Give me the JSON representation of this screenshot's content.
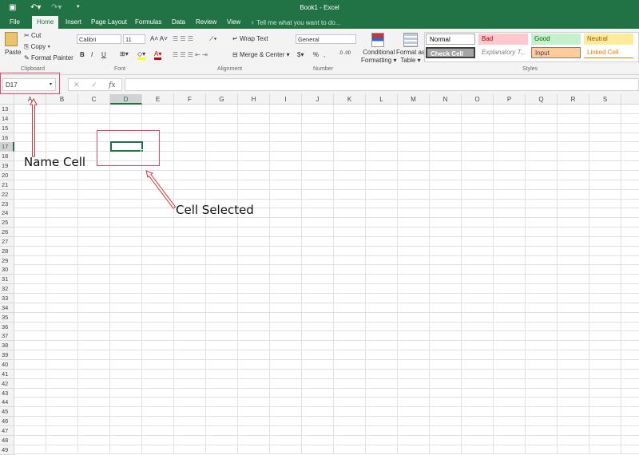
{
  "window": {
    "title": "Book1 - Excel"
  },
  "tabs": [
    "File",
    "Home",
    "Insert",
    "Page Layout",
    "Formulas",
    "Data",
    "Review",
    "View"
  ],
  "tell_me": "Tell me what you want to do...",
  "clipboard": {
    "paste": "Paste",
    "cut": "Cut",
    "copy": "Copy",
    "format_painter": "Format Painter",
    "label": "Clipboard"
  },
  "font": {
    "name": "Calibri",
    "size": "11",
    "bold": "B",
    "italic": "I",
    "underline": "U",
    "label": "Font"
  },
  "alignment": {
    "wrap": "Wrap Text",
    "merge": "Merge & Center",
    "label": "Alignment"
  },
  "number": {
    "format": "General",
    "percent": "%",
    "comma": ",",
    "label": "Number"
  },
  "styles": {
    "cond1": "Conditional",
    "cond2": "Formatting",
    "fmt1": "Format as",
    "fmt2": "Table",
    "label": "Styles",
    "cells": [
      {
        "t": "Normal",
        "bg": "#ffffff",
        "c": "#000"
      },
      {
        "t": "Bad",
        "bg": "#ffc7ce",
        "c": "#9c0006"
      },
      {
        "t": "Good",
        "bg": "#c6efce",
        "c": "#006100"
      },
      {
        "t": "Neutral",
        "bg": "#ffeb9c",
        "c": "#9c5700"
      },
      {
        "t": "Check Cell",
        "bg": "#a5a5a5",
        "c": "#ffffff"
      },
      {
        "t": "Explanatory T...",
        "bg": "#ffffff",
        "c": "#7f7f7f"
      },
      {
        "t": "Input",
        "bg": "#ffcc99",
        "c": "#3f3f76"
      },
      {
        "t": "Linked Cell",
        "bg": "#ffffff",
        "c": "#fa7d00"
      }
    ]
  },
  "name_box": "D17",
  "fx": "fx",
  "columns": [
    "A",
    "B",
    "C",
    "D",
    "E",
    "F",
    "G",
    "H",
    "I",
    "J",
    "K",
    "L",
    "M",
    "N",
    "O",
    "P",
    "Q",
    "R",
    "S"
  ],
  "rows": [
    "13",
    "14",
    "15",
    "16",
    "17",
    "18",
    "19",
    "20",
    "21",
    "22",
    "23",
    "24",
    "25",
    "26",
    "27",
    "28",
    "29",
    "30",
    "31",
    "32",
    "33",
    "34",
    "35",
    "36",
    "37",
    "38",
    "39",
    "40",
    "41",
    "42",
    "43",
    "44",
    "45",
    "46",
    "47",
    "48",
    "49"
  ],
  "annotations": {
    "name_cell": "Name Cell",
    "cell_selected": "Cell Selected"
  }
}
